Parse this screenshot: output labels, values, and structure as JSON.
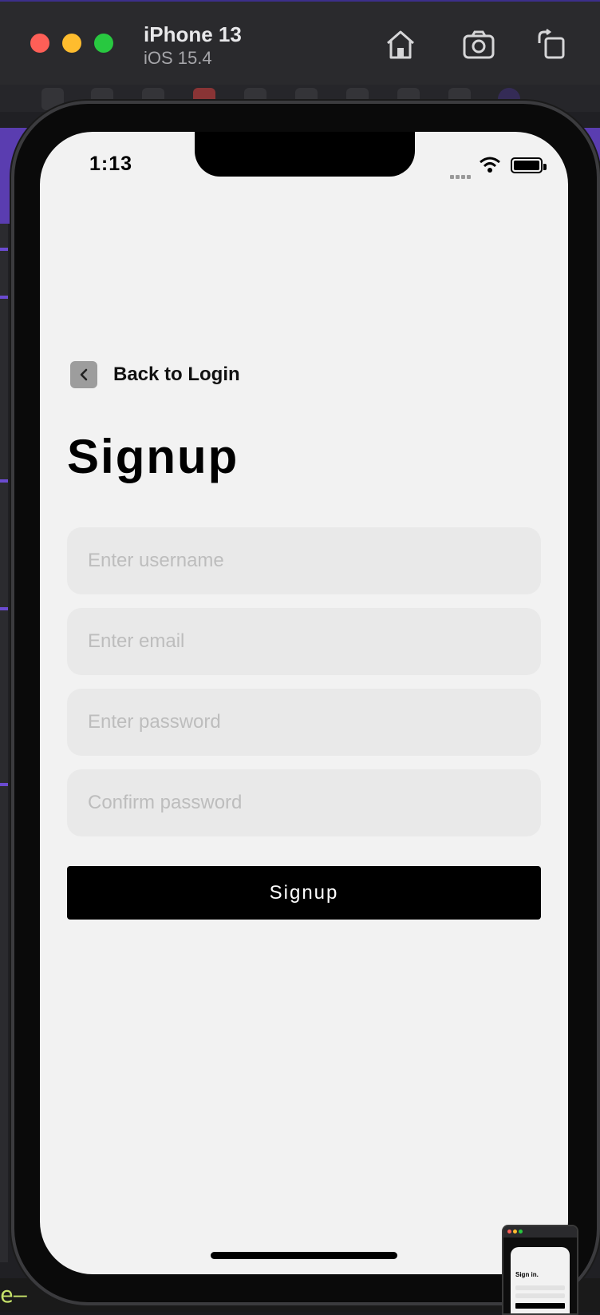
{
  "simulator": {
    "device_name": "iPhone 13",
    "os_version": "iOS 15.4",
    "toolbar_icons": [
      "home-icon",
      "screenshot-icon",
      "rotate-icon"
    ]
  },
  "status_bar": {
    "time": "1:13",
    "icons": [
      "signal-icon",
      "wifi-icon",
      "battery-icon"
    ]
  },
  "header": {
    "back_label": "Back to Login",
    "back_icon": "chevron-left-icon"
  },
  "form": {
    "title": "Signup",
    "username_placeholder": "Enter username",
    "email_placeholder": "Enter email",
    "password_placeholder": "Enter password",
    "confirm_placeholder": "Confirm password",
    "submit_label": "Signup"
  },
  "desktop": {
    "bottom_text": "e—"
  },
  "mini_preview": {
    "title": "Sign in."
  },
  "colors": {
    "screen_bg": "#f2f2f2",
    "field_bg": "#e9e9e9",
    "button_bg": "#000000",
    "button_text": "#ffffff",
    "back_button_bg": "#9d9d9d",
    "placeholder": "#bdbdbd"
  }
}
